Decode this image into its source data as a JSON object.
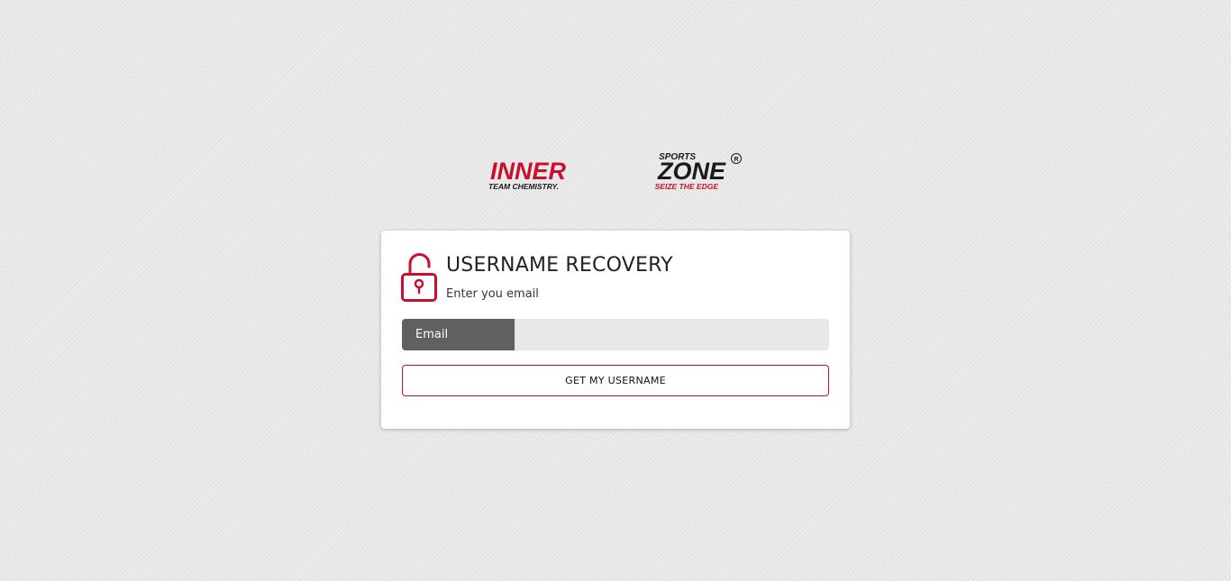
{
  "brand": {
    "logo_main_left": "INNER",
    "logo_main_right": "ZONE",
    "logo_small": "SPORTS",
    "logo_registered": "R",
    "tagline_left": "TEAM CHEMISTRY.",
    "tagline_right": "SEIZE THE EDGE",
    "colors": {
      "accent_red": "#c8102e",
      "dark": "#1a1a1a"
    }
  },
  "recovery": {
    "icon": "lock-icon",
    "title": "USERNAME RECOVERY",
    "subtitle": "Enter you email",
    "email_label": "Email",
    "email_value": "",
    "submit_label": "GET MY USERNAME"
  }
}
